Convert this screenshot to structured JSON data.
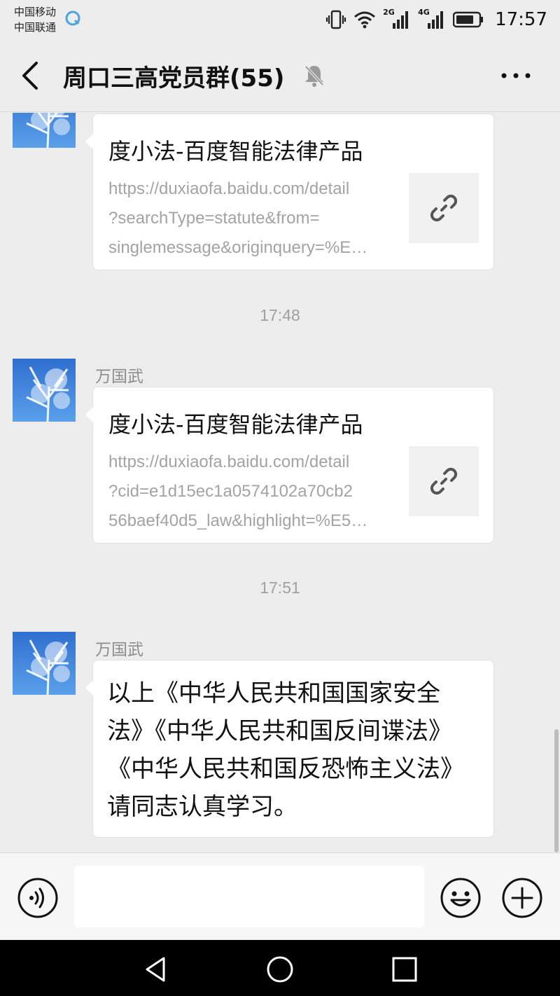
{
  "status_bar": {
    "carrier_1": "中国移动",
    "carrier_2": "中国联通",
    "net_2g": "2G",
    "net_4g": "4G",
    "time": "17:57"
  },
  "header": {
    "title": "周口三高党员群(55)",
    "icons": [
      "back-arrow-icon",
      "mute-bell-icon",
      "more-dots-icon"
    ]
  },
  "messages": [
    {
      "type": "link",
      "sender": "",
      "title": "度小法-百度智能法律产品",
      "url_lines": [
        "https://duxiaofa.baidu.com/detail",
        "?searchType=statute&from=",
        "singlemessage&originquery=%E…"
      ],
      "thumb_icon": "link-icon"
    },
    {
      "type": "time",
      "text": "17:48"
    },
    {
      "type": "link",
      "sender": "万国武",
      "title": "度小法-百度智能法律产品",
      "url_lines": [
        "https://duxiaofa.baidu.com/detail",
        "?cid=e1d15ec1a0574102a70cb2",
        "56baef40d5_law&highlight=%E5…"
      ],
      "thumb_icon": "link-icon"
    },
    {
      "type": "time",
      "text": "17:51"
    },
    {
      "type": "text",
      "sender": "万国武",
      "lines": [
        "以上《中华人民共和国国家安全",
        "法》《中华人民共和国反间谍法》",
        "《中华人民共和国反恐怖主义法》",
        "请同志认真学习。"
      ]
    }
  ],
  "input_bar": {
    "value": "",
    "icons": [
      "voice-icon",
      "emoji-icon",
      "plus-icon"
    ]
  },
  "nav_bar": {
    "icons": [
      "nav-back-icon",
      "nav-home-icon",
      "nav-recents-icon"
    ]
  },
  "colors": {
    "background": "#ededed",
    "bubble": "#ffffff",
    "secondary_text": "#a3a3a3"
  }
}
